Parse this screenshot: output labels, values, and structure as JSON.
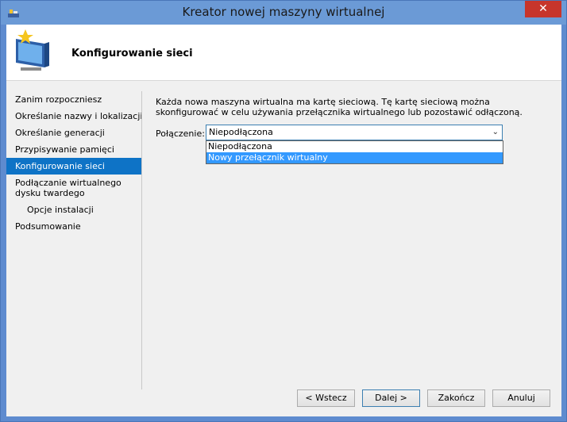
{
  "window": {
    "title": "Kreator nowej maszyny wirtualnej",
    "close_glyph": "✕"
  },
  "header": {
    "title": "Konfigurowanie sieci"
  },
  "nav": {
    "items": [
      {
        "label": "Zanim rozpoczniesz"
      },
      {
        "label": "Określanie nazwy i lokalizacji"
      },
      {
        "label": "Określanie generacji"
      },
      {
        "label": "Przypisywanie pamięci"
      },
      {
        "label": "Konfigurowanie sieci"
      },
      {
        "label": "Podłączanie wirtualnego dysku twardego"
      },
      {
        "label": "Opcje instalacji"
      },
      {
        "label": "Podsumowanie"
      }
    ]
  },
  "main": {
    "description": "Każda nowa maszyna wirtualna ma kartę sieciową. Tę kartę sieciową można skonfigurować w celu używania przełącznika wirtualnego lub pozostawić odłączoną.",
    "connection_label": "Połączenie:",
    "connection_value": "Niepodłączona",
    "options": [
      "Niepodłączona",
      "Nowy przełącznik wirtualny"
    ]
  },
  "buttons": {
    "back": "< Wstecz",
    "next": "Dalej >",
    "finish": "Zakończ",
    "cancel": "Anuluj"
  },
  "colors": {
    "accent": "#0e73c6",
    "titlebar": "#6b9ad6",
    "close": "#c7352b",
    "highlight": "#3399ff"
  }
}
